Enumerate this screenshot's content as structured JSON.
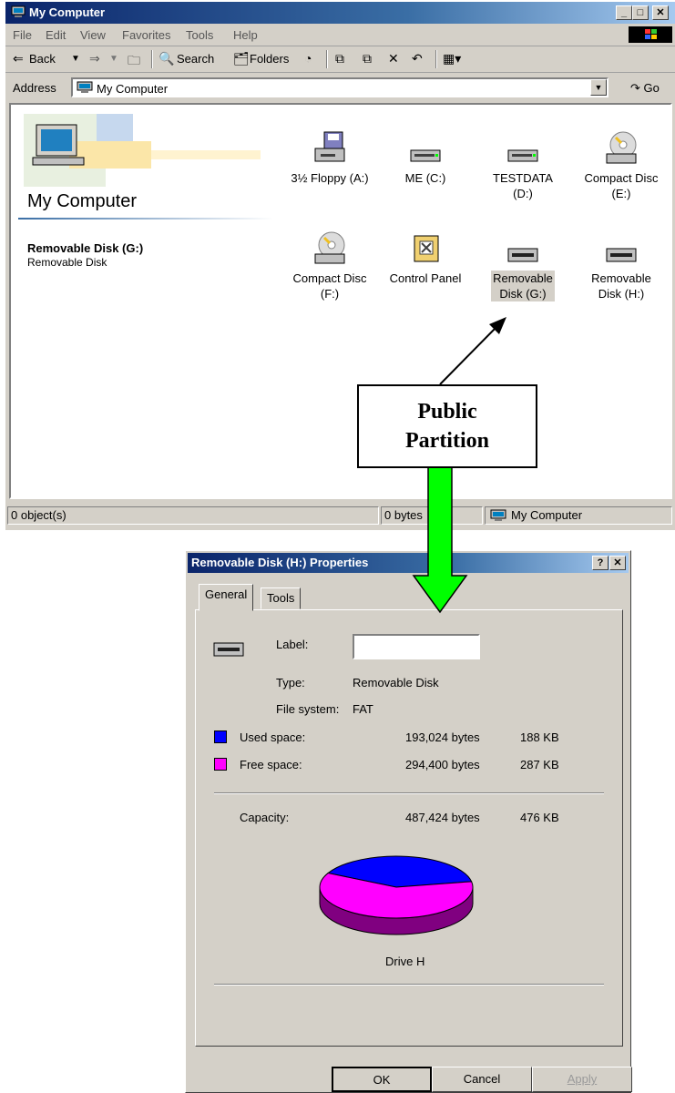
{
  "mycomputer": {
    "title": "My Computer",
    "menu": [
      "File",
      "Edit",
      "View",
      "Favorites",
      "Tools",
      "Help"
    ],
    "toolbar": {
      "back": "Back",
      "search": "Search",
      "folders": "Folders"
    },
    "address": {
      "label": "Address",
      "value": "My Computer",
      "go": "Go"
    },
    "banner_title": "My Computer",
    "selected": {
      "name": "Removable Disk (G:)",
      "type": "Removable Disk"
    },
    "drives": [
      {
        "line1": "3½ Floppy (A:)",
        "line2": "",
        "icon": "floppy-drive-icon"
      },
      {
        "line1": "ME (C:)",
        "line2": "",
        "icon": "hard-drive-icon"
      },
      {
        "line1": "TESTDATA",
        "line2": "(D:)",
        "icon": "hard-drive-icon"
      },
      {
        "line1": "Compact Disc",
        "line2": "(E:)",
        "icon": "cd-drive-icon"
      },
      {
        "line1": "Compact Disc",
        "line2": "(F:)",
        "icon": "cd-drive-icon"
      },
      {
        "line1": "Control Panel",
        "line2": "",
        "icon": "control-panel-icon"
      },
      {
        "line1": "Removable",
        "line2": "Disk (G:)",
        "icon": "removable-disk-icon"
      },
      {
        "line1": "Removable",
        "line2": "Disk (H:)",
        "icon": "removable-disk-icon"
      }
    ],
    "status": {
      "objects": "0 object(s)",
      "bytes": "0 bytes",
      "zone": "My Computer"
    }
  },
  "annotation": {
    "line1": "Public",
    "line2": "Partition",
    "arrow_color": "#00ff00"
  },
  "properties": {
    "title": "Removable Disk (H:) Properties",
    "tabs": [
      "General",
      "Tools"
    ],
    "label_label": "Label:",
    "label_value": "",
    "type_label": "Type:",
    "type_value": "Removable Disk",
    "fs_label": "File system:",
    "fs_value": "FAT",
    "used_label": "Used space:",
    "used_bytes": "193,024 bytes",
    "used_kb": "188 KB",
    "free_label": "Free space:",
    "free_bytes": "294,400 bytes",
    "free_kb": "287 KB",
    "capacity_label": "Capacity:",
    "capacity_bytes": "487,424 bytes",
    "capacity_kb": "476 KB",
    "drive_caption": "Drive H",
    "colors": {
      "used": "#0000ff",
      "free": "#ff00ff"
    },
    "used_fraction": 0.396,
    "buttons": {
      "ok": "OK",
      "cancel": "Cancel",
      "apply": "Apply"
    }
  }
}
